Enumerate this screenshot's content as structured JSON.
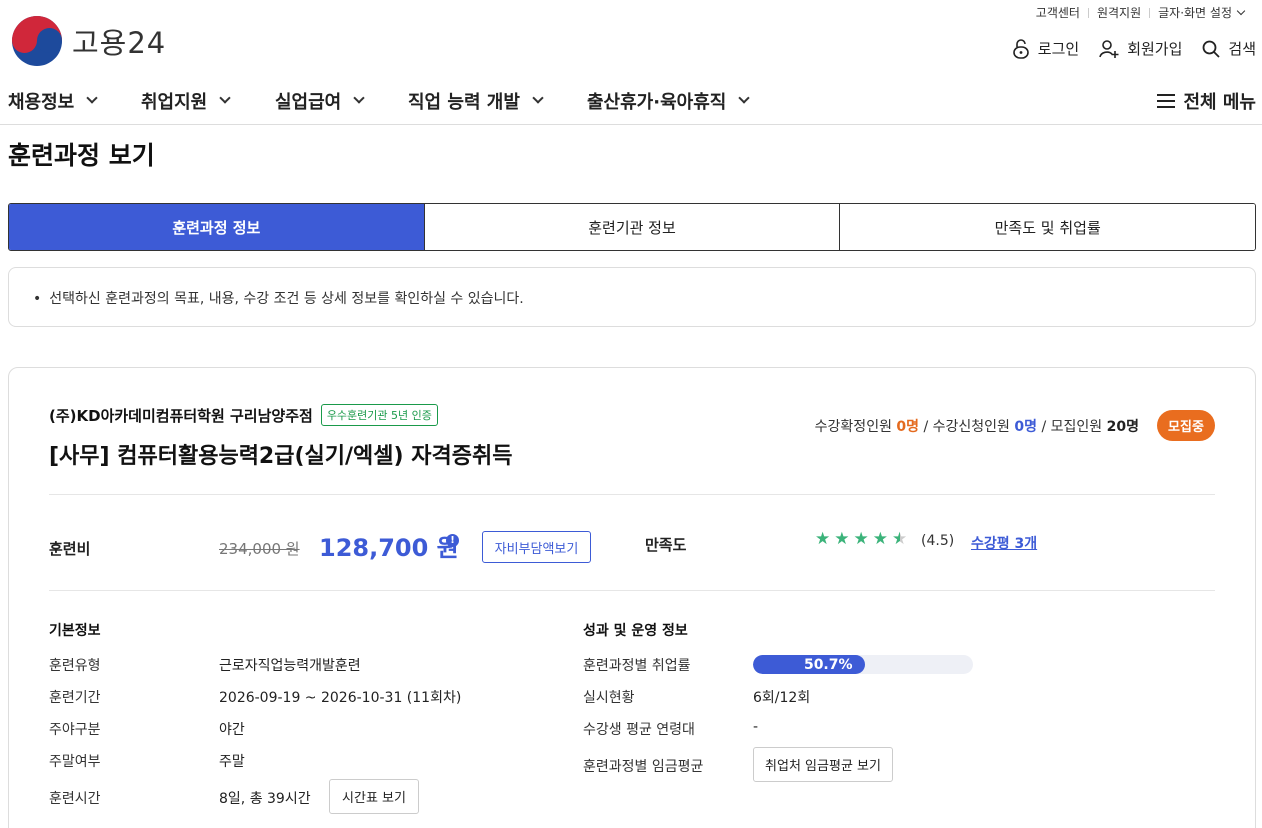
{
  "util": {
    "customer_center": "고객센터",
    "remote_support": "원격지원",
    "display_settings": "글자·화면 설정"
  },
  "logo": {
    "text": "고용24"
  },
  "user": {
    "login": "로그인",
    "signup": "회원가입",
    "search": "검색"
  },
  "gnb": {
    "items": [
      "채용정보",
      "취업지원",
      "실업급여",
      "직업 능력 개발",
      "출산휴가·육아휴직"
    ],
    "all_menu": "전체 메뉴"
  },
  "page_title": "훈련과정 보기",
  "tabs": [
    "훈련과정 정보",
    "훈련기관 정보",
    "만족도 및 취업률"
  ],
  "notice": "선택하신 훈련과정의 목표, 내용, 수강 조건 등 상세 정보를 확인하실 수 있습니다.",
  "course": {
    "institution": "(주)KD아카데미컴퓨터학원 구리남양주점",
    "inst_badge": "우수훈련기관 5년 인증",
    "title": "[사무] 컴퓨터활용능력2급(실기/엑셀) 자격증취득",
    "confirmed_label": "수강확정인원",
    "confirmed": "0명",
    "applied_label": "수강신청인원",
    "applied": "0명",
    "capacity_label": "모집인원",
    "capacity": "20명",
    "slash": "/",
    "status": "모집중",
    "fee_label": "훈련비",
    "fee_original": "234,000 원",
    "fee_now": "128,700 원",
    "info_glyph": "!",
    "selfpay_button": "자비부담액보기",
    "satisfaction_label": "만족도",
    "rating": 4.5,
    "rating_text": "(4.5)",
    "reviews": "수강평 3개",
    "star_glyph": "★",
    "basic_title": "기본정보",
    "basic": [
      {
        "label": "훈련유형",
        "value": "근로자직업능력개발훈련"
      },
      {
        "label": "훈련기간",
        "value": "2026-09-19 ~ 2026-10-31 (11회차)"
      },
      {
        "label": "주야구분",
        "value": "야간"
      },
      {
        "label": "주말여부",
        "value": "주말"
      },
      {
        "label": "훈련시간",
        "value": "8일, 총 39시간"
      }
    ],
    "timetable_button": "시간표 보기",
    "perf_title": "성과 및 운영 정보",
    "perf": [
      {
        "label": "훈련과정별 취업률",
        "value": "50.7%"
      },
      {
        "label": "실시현황",
        "value": "6회/12회"
      },
      {
        "label": "수강생 평균 연령대",
        "value": "-"
      },
      {
        "label": "훈련과정별 임금평균",
        "value": ""
      }
    ],
    "employment_rate": 50.7,
    "wage_button": "취업처 임금평균 보기"
  },
  "colors": {
    "primary": "#3d5bd6",
    "orange": "#e96d1f",
    "green": "#1a9a4a",
    "star": "#3bb37a"
  }
}
